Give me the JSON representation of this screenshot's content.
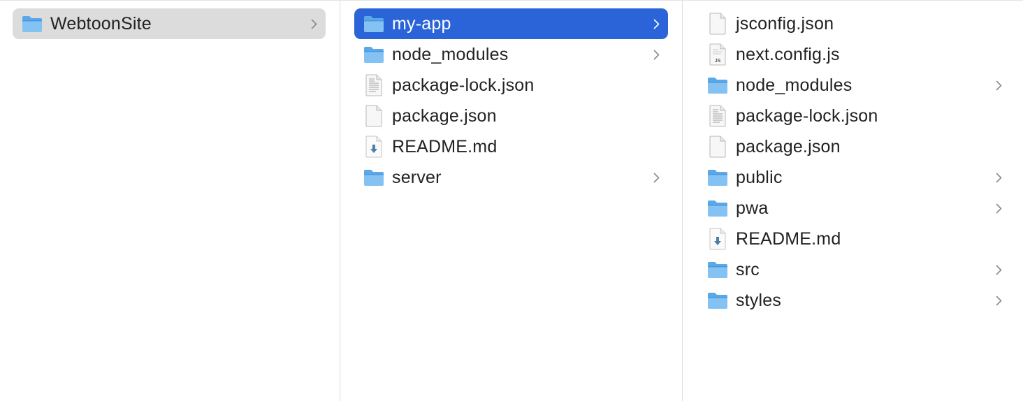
{
  "colors": {
    "selection_active": "#2b64d9",
    "selection_inactive": "#dcdcdc",
    "folder": "#5aa8ea"
  },
  "columns": [
    {
      "items": [
        {
          "label": "WebtoonSite",
          "icon": "folder-icon",
          "has_children": true,
          "selected": "inactive"
        }
      ]
    },
    {
      "items": [
        {
          "label": "my-app",
          "icon": "folder-icon",
          "has_children": true,
          "selected": "active"
        },
        {
          "label": "node_modules",
          "icon": "folder-icon",
          "has_children": true
        },
        {
          "label": "package-lock.json",
          "icon": "text-document-icon",
          "has_children": false
        },
        {
          "label": "package.json",
          "icon": "blank-document-icon",
          "has_children": false
        },
        {
          "label": "README.md",
          "icon": "markdown-document-icon",
          "has_children": false
        },
        {
          "label": "server",
          "icon": "folder-icon",
          "has_children": true
        }
      ]
    },
    {
      "items": [
        {
          "label": "jsconfig.json",
          "icon": "blank-document-icon",
          "has_children": false
        },
        {
          "label": "next.config.js",
          "icon": "js-document-icon",
          "badge": "JS",
          "has_children": false
        },
        {
          "label": "node_modules",
          "icon": "folder-icon",
          "has_children": true
        },
        {
          "label": "package-lock.json",
          "icon": "text-document-icon",
          "has_children": false
        },
        {
          "label": "package.json",
          "icon": "blank-document-icon",
          "has_children": false
        },
        {
          "label": "public",
          "icon": "folder-icon",
          "has_children": true
        },
        {
          "label": "pwa",
          "icon": "folder-icon",
          "has_children": true
        },
        {
          "label": "README.md",
          "icon": "markdown-document-icon",
          "has_children": false
        },
        {
          "label": "src",
          "icon": "folder-icon",
          "has_children": true
        },
        {
          "label": "styles",
          "icon": "folder-icon",
          "has_children": true
        }
      ]
    }
  ]
}
